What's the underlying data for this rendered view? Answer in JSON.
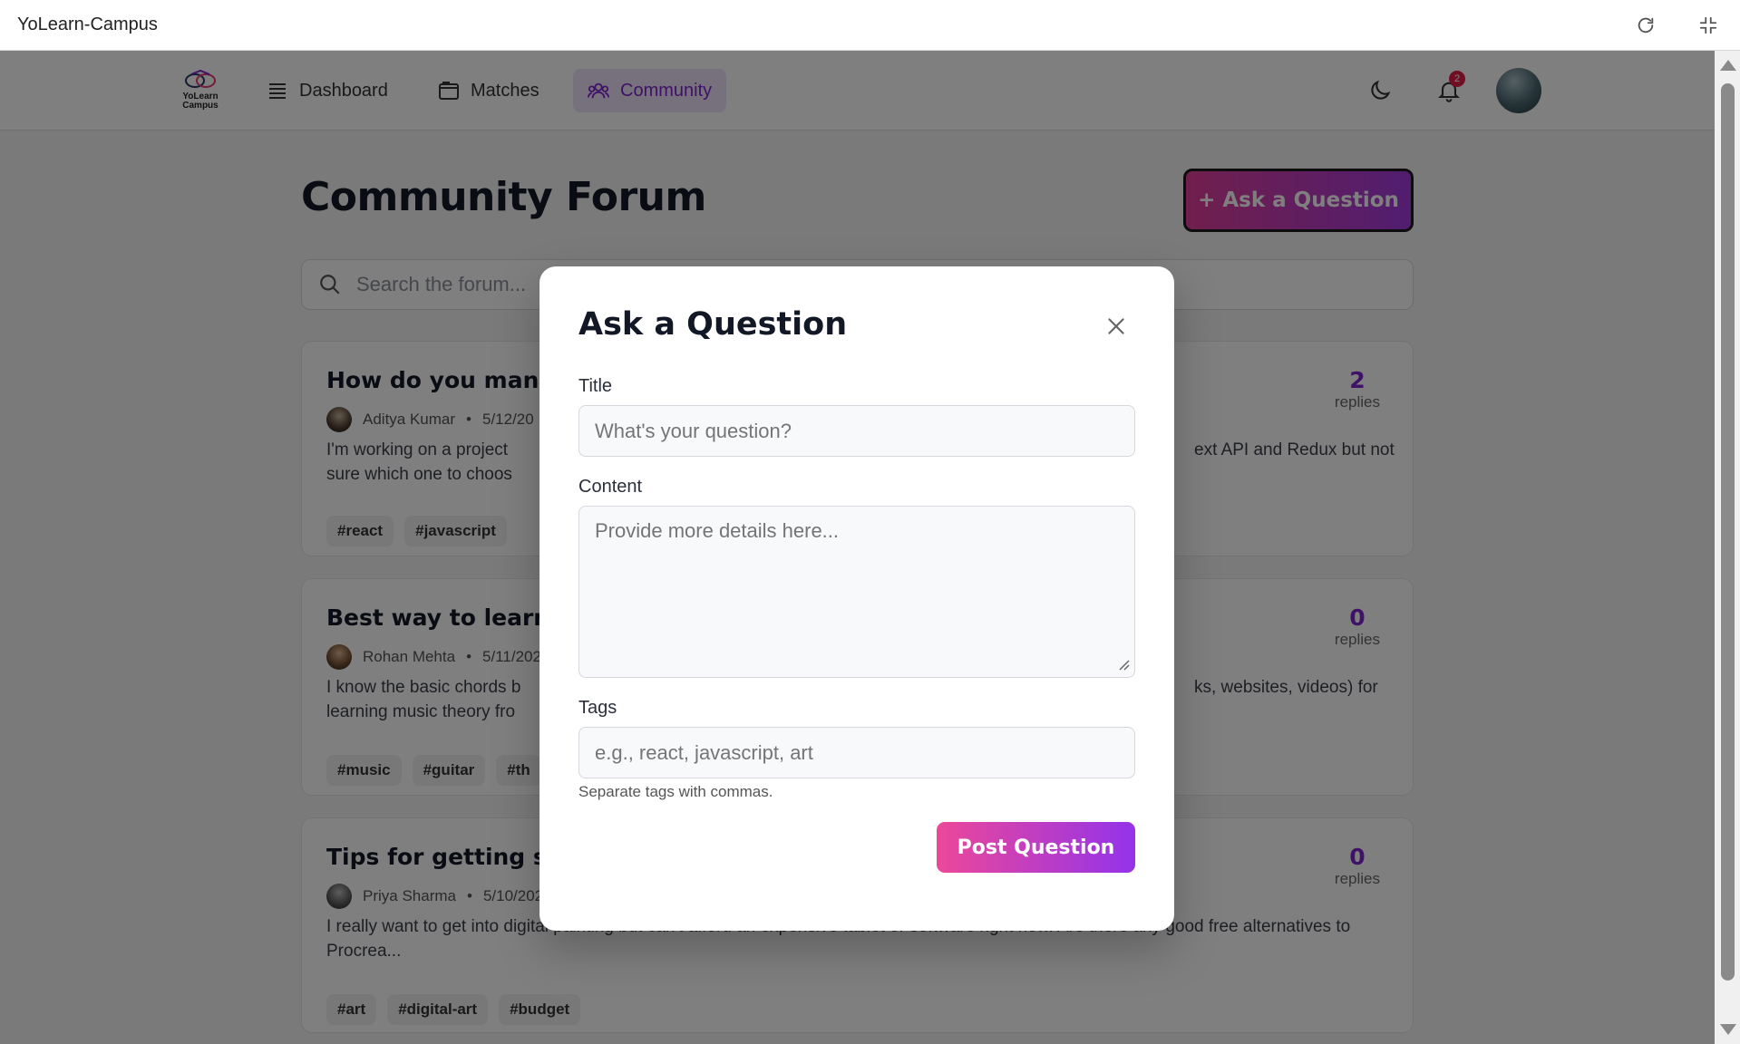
{
  "window": {
    "title": "YoLearn-Campus"
  },
  "nav": {
    "logo_line1": "YoLearn",
    "logo_line2": "Campus",
    "items": [
      {
        "label": "Dashboard",
        "icon": "list-icon"
      },
      {
        "label": "Matches",
        "icon": "folder-icon"
      },
      {
        "label": "Community",
        "icon": "people-icon",
        "active": true
      }
    ],
    "notification_count": "2",
    "accent": "#7e22ce"
  },
  "page": {
    "title": "Community Forum",
    "ask_button": "+ Ask a Question",
    "search_placeholder": "Search the forum..."
  },
  "posts": [
    {
      "title": "How do you manag",
      "author": "Aditya Kumar",
      "date": "5/12/20",
      "body_left": "I'm working on a project ",
      "body_right": "ext API and Redux but not",
      "body_line2": "sure which one to choos",
      "tags": [
        "#react",
        "#javascript"
      ],
      "replies": "2",
      "replies_label": "replies"
    },
    {
      "title": "Best way to learn m",
      "author": "Rohan Mehta",
      "date": "5/11/202",
      "body_left": "I know the basic chords b",
      "body_right": "ks, websites, videos) for",
      "body_line2": "learning music theory fro",
      "tags": [
        "#music",
        "#guitar",
        "#th"
      ],
      "replies": "0",
      "replies_label": "replies"
    },
    {
      "title": "Tips for getting sta",
      "author": "Priya Sharma",
      "date": "5/10/2024",
      "body": "I really want to get into digital painting but can't afford an expensive tablet or software right now. Are there any good free alternatives to Procrea...",
      "tags": [
        "#art",
        "#digital-art",
        "#budget"
      ],
      "replies": "0",
      "replies_label": "replies"
    }
  ],
  "modal": {
    "title": "Ask a Question",
    "title_label": "Title",
    "title_placeholder": "What's your question?",
    "content_label": "Content",
    "content_placeholder": "Provide more details here...",
    "tags_label": "Tags",
    "tags_placeholder": "e.g., react, javascript, art",
    "tags_help": "Separate tags with commas.",
    "submit": "Post Question"
  }
}
